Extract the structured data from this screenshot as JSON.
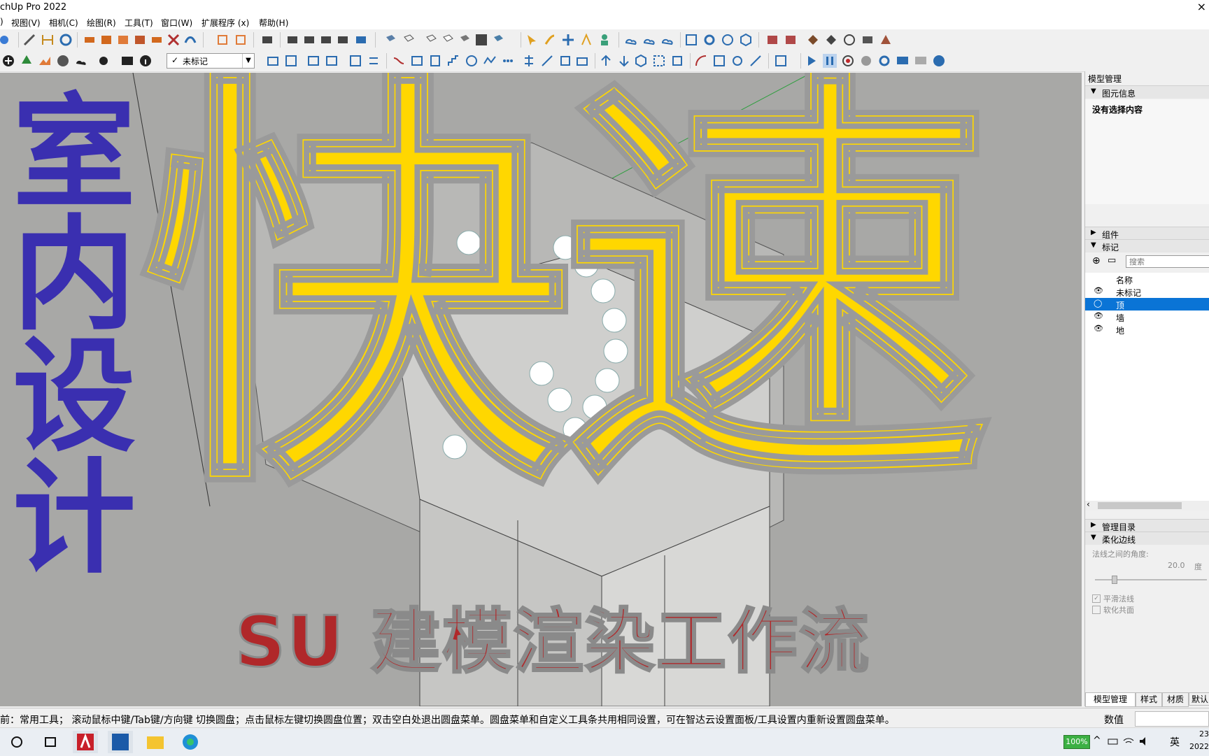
{
  "window": {
    "title": "chUp Pro 2022",
    "close_glyph": "×"
  },
  "menu": {
    "items": [
      {
        "label": ")"
      },
      {
        "label": "视图(V)"
      },
      {
        "label": "相机(C)"
      },
      {
        "label": "绘图(R)"
      },
      {
        "label": "工具(T)"
      },
      {
        "label": "窗口(W)"
      },
      {
        "label": "扩展程序 (x)"
      },
      {
        "label": "帮助(H)"
      }
    ]
  },
  "toolbar": {
    "tag_selector_value": "未标记",
    "tag_check": "✓"
  },
  "overlay": {
    "main_title": [
      "快",
      "速"
    ],
    "left_title": [
      "室",
      "内",
      "设",
      "计"
    ],
    "subtitle": "SU 建模渲染工作流",
    "colors": {
      "yellow": "#ffd700",
      "blue": "#3a2fb0",
      "red": "#b0282a"
    }
  },
  "panel": {
    "title": "模型管理",
    "entity_info": {
      "header": "图元信息",
      "text": "没有选择内容"
    },
    "components": {
      "header": "组件"
    },
    "tags": {
      "header": "标记",
      "search_placeholder": "搜索",
      "col_name": "名称",
      "rows": [
        {
          "name": "未标记",
          "selected": false
        },
        {
          "name": "顶",
          "selected": true
        },
        {
          "name": "墙",
          "selected": false
        },
        {
          "name": "地",
          "selected": false
        }
      ]
    },
    "outliner": {
      "header": "管理目录"
    },
    "soften": {
      "header": "柔化边线",
      "angle_label": "法线之间的角度:",
      "angle_value": "20.0",
      "angle_unit": "度",
      "smooth_label": "平滑法线",
      "coplanar_label": "软化共面",
      "smooth_checked": true,
      "coplanar_checked": false
    },
    "tabs": [
      {
        "label": "模型管理"
      },
      {
        "label": "样式"
      },
      {
        "label": "材质"
      },
      {
        "label": "默认"
      }
    ]
  },
  "status": {
    "text": "前：常用工具； 滚动鼠标中键/Tab键/方向键 切换圆盘；点击鼠标左键切换圆盘位置；双击空白处退出圆盘菜单。圆盘菜单和自定义工具条共用相同设置，可在智达云设置面板/工具设置内重新设置圆盘菜单。",
    "measurement_label": "数值"
  },
  "taskbar": {
    "battery": "100%",
    "ime": "英",
    "clock_top": "23",
    "clock_bottom": "2022"
  }
}
